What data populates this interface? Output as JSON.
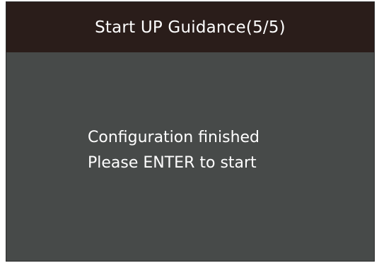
{
  "header": {
    "title": "Start UP Guidance(5/5)"
  },
  "main": {
    "line1": "Configuration finished",
    "line2": "Please ENTER to start"
  },
  "colors": {
    "title_bar": "#2a1d1a",
    "screen_bg": "#474a49",
    "text": "#ffffff"
  }
}
